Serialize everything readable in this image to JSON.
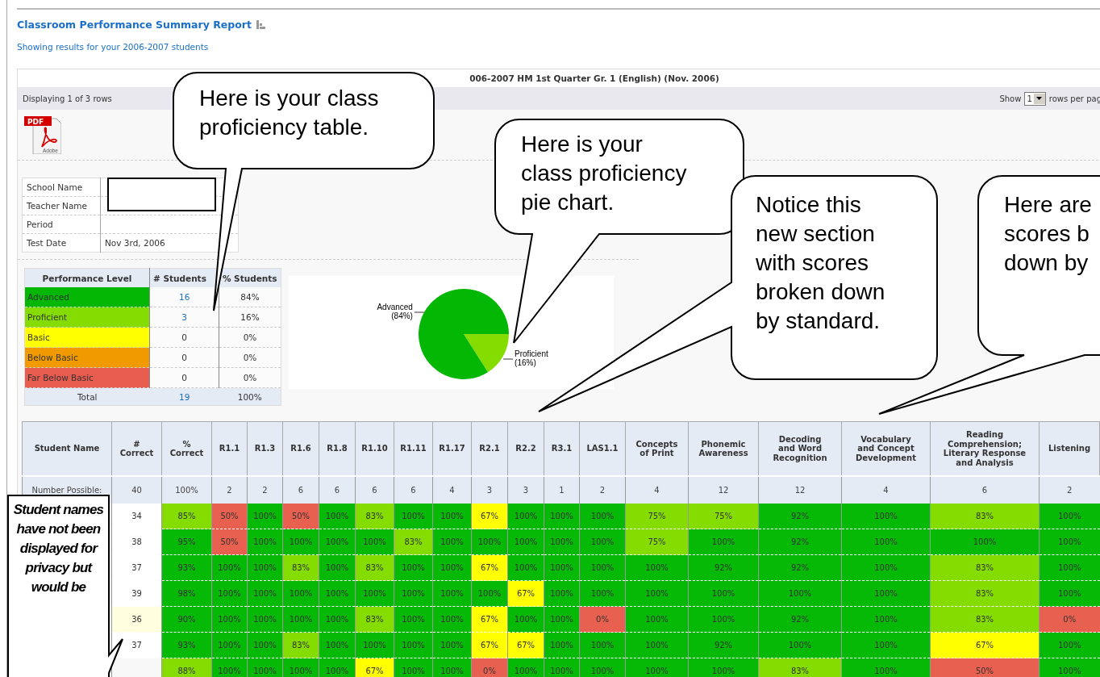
{
  "report": {
    "title": "Classroom Performance Summary Report",
    "subtitle": "Showing results for your 2006-2007 students"
  },
  "panel": {
    "heading": "006-2007 HM 1st Quarter Gr. 1 (English) (Nov. 2006)"
  },
  "pager": {
    "status": "Displaying 1 of 3 rows",
    "show_label": "Show",
    "rows_value": "1",
    "suffix": "rows per pag"
  },
  "pdf_icon": {
    "badge": "PDF",
    "caption": "Adobe"
  },
  "info": [
    {
      "label": "School Name"
    },
    {
      "label": "Teacher Name"
    },
    {
      "label": "Period"
    },
    {
      "label": "Test Date",
      "value": "Nov 3rd, 2006"
    }
  ],
  "performance": {
    "columns": [
      "Performance Level",
      "# Students",
      "% Students"
    ],
    "levels": [
      {
        "name": "Advanced",
        "color": "#05b705",
        "count": "16",
        "percent": "84%",
        "link": true
      },
      {
        "name": "Proficient",
        "color": "#84dc00",
        "count": "3",
        "percent": "16%",
        "link": true
      },
      {
        "name": "Basic",
        "color": "#ffff00",
        "count": "0",
        "percent": "0%",
        "link": false
      },
      {
        "name": "Below Basic",
        "color": "#f09a00",
        "count": "0",
        "percent": "0%",
        "link": false
      },
      {
        "name": "Far Below Basic",
        "color": "#e85c50",
        "count": "0",
        "percent": "0%",
        "link": false
      }
    ],
    "total": {
      "label": "Total",
      "count": "19",
      "percent": "100%",
      "link": true
    }
  },
  "pie_panel": {
    "chart_data": {
      "type": "pie",
      "categories": [
        "Proficient",
        "Advanced"
      ],
      "values": [
        16,
        84
      ],
      "colors": [
        "#84dc00",
        "#05b705"
      ],
      "value_labels": [
        "(16%)",
        "(84%)"
      ]
    }
  },
  "scores": {
    "columns": [
      {
        "label": "Student Name",
        "possible": "Number Possible:"
      },
      {
        "label": "#\nCorrect",
        "possible": "40"
      },
      {
        "label": "%\nCorrect",
        "possible": "100%"
      },
      {
        "label": "R1.1",
        "possible": "2"
      },
      {
        "label": "R1.3",
        "possible": "2"
      },
      {
        "label": "R1.6",
        "possible": "6"
      },
      {
        "label": "R1.8",
        "possible": "6"
      },
      {
        "label": "R1.10",
        "possible": "6"
      },
      {
        "label": "R1.11",
        "possible": "6"
      },
      {
        "label": "R1.17",
        "possible": "4"
      },
      {
        "label": "R2.1",
        "possible": "3"
      },
      {
        "label": "R2.2",
        "possible": "3"
      },
      {
        "label": "R3.1",
        "possible": "1"
      },
      {
        "label": "LAS1.1",
        "possible": "2"
      },
      {
        "label": "Concepts\nof Print",
        "possible": "4"
      },
      {
        "label": "Phonemic\nAwareness",
        "possible": "12"
      },
      {
        "label": "Decoding\nand Word\nRecognition",
        "possible": "12"
      },
      {
        "label": "Vocabulary\nand Concept\nDevelopment",
        "possible": "4"
      },
      {
        "label": "Reading\nComprehension;\nLiterary Response\nand Analysis",
        "possible": "6"
      },
      {
        "label": "Listening",
        "possible": "2"
      }
    ],
    "rows": [
      {
        "cells": [
          {},
          {
            "v": "34",
            "highlighted": false
          },
          {
            "v": "85%",
            "color": "#84dc00"
          },
          {
            "v": "50%",
            "color": "#e8604f"
          },
          {
            "v": "100%",
            "color": "#06b906"
          },
          {
            "v": "50%",
            "color": "#e8604f"
          },
          {
            "v": "100%",
            "color": "#06b906"
          },
          {
            "v": "83%",
            "color": "#84dc00"
          },
          {
            "v": "100%",
            "color": "#06b906"
          },
          {
            "v": "100%",
            "color": "#06b906"
          },
          {
            "v": "67%",
            "color": "#ffff00"
          },
          {
            "v": "100%",
            "color": "#06b906"
          },
          {
            "v": "100%",
            "color": "#06b906"
          },
          {
            "v": "100%",
            "color": "#06b906"
          },
          {
            "v": "75%",
            "color": "#84dc00"
          },
          {
            "v": "75%",
            "color": "#84dc00"
          },
          {
            "v": "92%",
            "color": "#06b906"
          },
          {
            "v": "100%",
            "color": "#06b906"
          },
          {
            "v": "83%",
            "color": "#84dc00"
          },
          {
            "v": "100%",
            "color": "#06b906"
          }
        ]
      },
      {
        "cells": [
          {},
          {
            "v": "38",
            "highlighted": false
          },
          {
            "v": "95%",
            "color": "#06b906"
          },
          {
            "v": "50%",
            "color": "#e8604f"
          },
          {
            "v": "100%",
            "color": "#06b906"
          },
          {
            "v": "100%",
            "color": "#06b906"
          },
          {
            "v": "100%",
            "color": "#06b906"
          },
          {
            "v": "100%",
            "color": "#06b906"
          },
          {
            "v": "83%",
            "color": "#84dc00"
          },
          {
            "v": "100%",
            "color": "#06b906"
          },
          {
            "v": "100%",
            "color": "#06b906"
          },
          {
            "v": "100%",
            "color": "#06b906"
          },
          {
            "v": "100%",
            "color": "#06b906"
          },
          {
            "v": "100%",
            "color": "#06b906"
          },
          {
            "v": "75%",
            "color": "#84dc00"
          },
          {
            "v": "100%",
            "color": "#06b906"
          },
          {
            "v": "92%",
            "color": "#06b906"
          },
          {
            "v": "100%",
            "color": "#06b906"
          },
          {
            "v": "100%",
            "color": "#06b906"
          },
          {
            "v": "100%",
            "color": "#06b906"
          }
        ]
      },
      {
        "cells": [
          {},
          {
            "v": "37",
            "highlighted": false
          },
          {
            "v": "93%",
            "color": "#06b906"
          },
          {
            "v": "100%",
            "color": "#06b906"
          },
          {
            "v": "100%",
            "color": "#06b906"
          },
          {
            "v": "83%",
            "color": "#84dc00"
          },
          {
            "v": "100%",
            "color": "#06b906"
          },
          {
            "v": "83%",
            "color": "#84dc00"
          },
          {
            "v": "100%",
            "color": "#06b906"
          },
          {
            "v": "100%",
            "color": "#06b906"
          },
          {
            "v": "67%",
            "color": "#ffff00"
          },
          {
            "v": "100%",
            "color": "#06b906"
          },
          {
            "v": "100%",
            "color": "#06b906"
          },
          {
            "v": "100%",
            "color": "#06b906"
          },
          {
            "v": "100%",
            "color": "#06b906"
          },
          {
            "v": "92%",
            "color": "#06b906"
          },
          {
            "v": "92%",
            "color": "#06b906"
          },
          {
            "v": "100%",
            "color": "#06b906"
          },
          {
            "v": "83%",
            "color": "#84dc00"
          },
          {
            "v": "100%",
            "color": "#06b906"
          }
        ]
      },
      {
        "cells": [
          {},
          {
            "v": "39",
            "highlighted": false
          },
          {
            "v": "98%",
            "color": "#06b906"
          },
          {
            "v": "100%",
            "color": "#06b906"
          },
          {
            "v": "100%",
            "color": "#06b906"
          },
          {
            "v": "100%",
            "color": "#06b906"
          },
          {
            "v": "100%",
            "color": "#06b906"
          },
          {
            "v": "100%",
            "color": "#06b906"
          },
          {
            "v": "100%",
            "color": "#06b906"
          },
          {
            "v": "100%",
            "color": "#06b906"
          },
          {
            "v": "100%",
            "color": "#06b906"
          },
          {
            "v": "67%",
            "color": "#ffff00"
          },
          {
            "v": "100%",
            "color": "#06b906"
          },
          {
            "v": "100%",
            "color": "#06b906"
          },
          {
            "v": "100%",
            "color": "#06b906"
          },
          {
            "v": "100%",
            "color": "#06b906"
          },
          {
            "v": "100%",
            "color": "#06b906"
          },
          {
            "v": "100%",
            "color": "#06b906"
          },
          {
            "v": "83%",
            "color": "#84dc00"
          },
          {
            "v": "100%",
            "color": "#06b906"
          }
        ]
      },
      {
        "cells": [
          {},
          {
            "v": "36",
            "highlighted": true
          },
          {
            "v": "90%",
            "color": "#06b906"
          },
          {
            "v": "100%",
            "color": "#06b906"
          },
          {
            "v": "100%",
            "color": "#06b906"
          },
          {
            "v": "100%",
            "color": "#06b906"
          },
          {
            "v": "100%",
            "color": "#06b906"
          },
          {
            "v": "83%",
            "color": "#84dc00"
          },
          {
            "v": "100%",
            "color": "#06b906"
          },
          {
            "v": "100%",
            "color": "#06b906"
          },
          {
            "v": "67%",
            "color": "#ffff00"
          },
          {
            "v": "100%",
            "color": "#06b906"
          },
          {
            "v": "100%",
            "color": "#06b906"
          },
          {
            "v": "0%",
            "color": "#e8604f"
          },
          {
            "v": "100%",
            "color": "#06b906"
          },
          {
            "v": "100%",
            "color": "#06b906"
          },
          {
            "v": "92%",
            "color": "#06b906"
          },
          {
            "v": "100%",
            "color": "#06b906"
          },
          {
            "v": "83%",
            "color": "#84dc00"
          },
          {
            "v": "0%",
            "color": "#e8604f"
          }
        ]
      },
      {
        "cells": [
          {},
          {
            "v": "37",
            "highlighted": false
          },
          {
            "v": "93%",
            "color": "#06b906"
          },
          {
            "v": "100%",
            "color": "#06b906"
          },
          {
            "v": "100%",
            "color": "#06b906"
          },
          {
            "v": "83%",
            "color": "#84dc00"
          },
          {
            "v": "100%",
            "color": "#06b906"
          },
          {
            "v": "100%",
            "color": "#06b906"
          },
          {
            "v": "100%",
            "color": "#06b906"
          },
          {
            "v": "100%",
            "color": "#06b906"
          },
          {
            "v": "67%",
            "color": "#ffff00"
          },
          {
            "v": "67%",
            "color": "#ffff00"
          },
          {
            "v": "100%",
            "color": "#06b906"
          },
          {
            "v": "100%",
            "color": "#06b906"
          },
          {
            "v": "100%",
            "color": "#06b906"
          },
          {
            "v": "92%",
            "color": "#06b906"
          },
          {
            "v": "100%",
            "color": "#06b906"
          },
          {
            "v": "100%",
            "color": "#06b906"
          },
          {
            "v": "67%",
            "color": "#ffff00"
          },
          {
            "v": "100%",
            "color": "#06b906"
          }
        ]
      },
      {
        "cells": [
          {},
          {},
          {
            "v": "88%",
            "color": "#84dc00"
          },
          {
            "v": "100%",
            "color": "#06b906"
          },
          {
            "v": "100%",
            "color": "#06b906"
          },
          {
            "v": "100%",
            "color": "#06b906"
          },
          {
            "v": "100%",
            "color": "#06b906"
          },
          {
            "v": "67%",
            "color": "#ffff00"
          },
          {
            "v": "100%",
            "color": "#06b906"
          },
          {
            "v": "100%",
            "color": "#06b906"
          },
          {
            "v": "0%",
            "color": "#e8604f"
          },
          {
            "v": "100%",
            "color": "#06b906"
          },
          {
            "v": "100%",
            "color": "#06b906"
          },
          {
            "v": "100%",
            "color": "#06b906"
          },
          {
            "v": "100%",
            "color": "#06b906"
          },
          {
            "v": "100%",
            "color": "#06b906"
          },
          {
            "v": "83%",
            "color": "#84dc00"
          },
          {
            "v": "100%",
            "color": "#06b906"
          },
          {
            "v": "50%",
            "color": "#e8604f"
          },
          {
            "v": "100%",
            "color": "#06b906"
          }
        ]
      }
    ]
  },
  "callouts": [
    {
      "kind": "bubble",
      "text": "Here is your class\nproficiency table."
    },
    {
      "kind": "bubble",
      "text": "Here is your\nclass proficiency\npie chart."
    },
    {
      "kind": "bubble",
      "text": "Notice this\nnew section\nwith scores\nbroken down\nby standard."
    },
    {
      "kind": "bubble",
      "text": "Here are\nscores b\ndown by"
    },
    {
      "kind": "note",
      "text": "Student names have not been displayed for privacy but would be"
    }
  ]
}
